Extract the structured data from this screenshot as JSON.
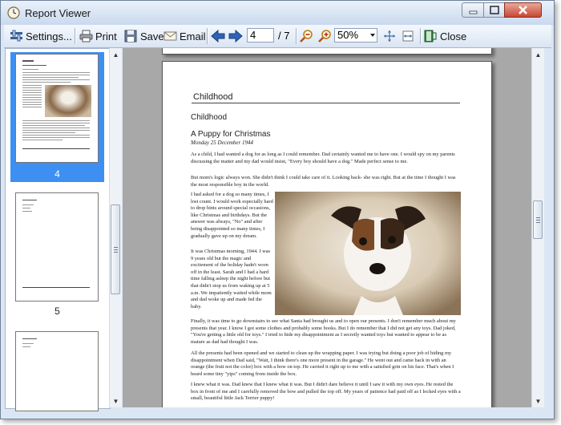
{
  "window": {
    "title": "Report Viewer"
  },
  "toolbar": {
    "settings": "Settings...",
    "print": "Print",
    "save": "Save",
    "email": "Email",
    "page_current": "4",
    "page_total": "/ 7",
    "zoom": "50%",
    "close": "Close"
  },
  "thumbnails": [
    {
      "label": "4",
      "selected": true
    },
    {
      "label": "5",
      "selected": false
    },
    {
      "label": "",
      "selected": false
    }
  ],
  "document": {
    "header": "Childhood",
    "section": "Childhood",
    "story_title": "A Puppy for Christmas",
    "story_date": "Monday 25 December 1944",
    "p1": "As a child, I had wanted a dog for as long as I could remember. Dad certainly wanted me to have one. I would spy on my parents discussing the matter and my dad would insist, \"Every boy should have a dog.\" Made perfect sense to me.",
    "p2": "But mom's logic always won. She didn't think I could take care of it. Looking back- she was right. But at the time I thought I was the most responsible boy in the world.",
    "p3": "I had asked for a dog so many times, I lost count. I would work especially hard to drop hints around special occasions, like Christmas and birthdays. But the answer was always, \"No\" and after being disappointed so many times, I gradually gave up on my dream.",
    "p4": "It was Christmas morning, 1944. I was 9 years old but the magic and excitement of the holiday hadn't worn off in the least. Sarah and I had a hard time falling asleep the night before but that didn't stop us from waking up at 5 a.m. We impatiently waited while mom and dad woke up and made fed the baby.",
    "p5": "Finally, it was time to go downstairs to see what Santa had brought us and to open our presents. I don't remember much about my presents that year. I know I got some clothes and probably some books. But I do remember that I did not get any toys. Dad joked, \"You're getting a little old for toys.\" I tried to hide my disappointment as I secretly wanted toys but wanted to appear to be as mature as dad had thought I was.",
    "p6": "All the presents had been opened and we started to clean up the wrapping paper. I was trying but doing a poor job of hiding my disappointment when Dad said, \"Wait, I think there's one more present in the garage.\" He went out and came back in with an orange (the fruit not the color) box with a bow on top. He carried it right up to me with a satisfied grin on his face. That's when I heard some tiny \"yips\" coming from inside the box.",
    "p7": "I knew what it was. Dad knew that I knew what it was. But I didn't dare believe it until I saw it with my own eyes. He rested the box in front of me and I carefully removed the bow and pulled the top off. My years of patience had paid off as I locked eyes with a small, beautiful little Jack Terrier puppy!"
  },
  "colors": {
    "selection": "#3d8ff2",
    "viewer_bg": "#a8a8a8",
    "chrome": "#dbe6f4"
  },
  "icons": [
    "clock-icon",
    "settings-icon",
    "print-icon",
    "save-icon",
    "email-icon",
    "arrow-left-icon",
    "arrow-right-icon",
    "zoom-out-icon",
    "zoom-in-icon",
    "fit-page-icon",
    "fit-width-icon",
    "close-book-icon",
    "dog-photo"
  ]
}
